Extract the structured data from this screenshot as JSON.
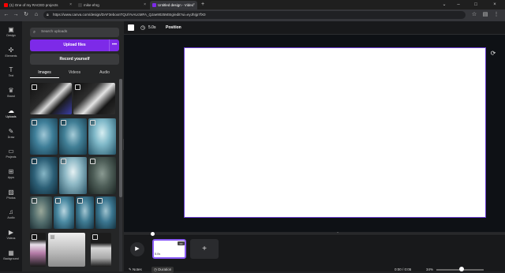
{
  "browser": {
    "tabs": [
      {
        "label": "(1) One of my RACED projects",
        "favicon_color": "#ff0000"
      },
      {
        "label": "mike ehrg",
        "favicon_color": "#3a3a3a"
      },
      {
        "label": "Untitled design - Video",
        "favicon_color": "#7d2ae8"
      }
    ],
    "new_tab_symbol": "+",
    "url": "https://www.canva.com/design/DAF3eboxnTQU/YvAUcMFA_QJae9025MSIg/edit?ui=eyJhIjp7fX0"
  },
  "rail": {
    "items": [
      {
        "label": "Design",
        "icon": "design-icon",
        "glyph": "▣"
      },
      {
        "label": "Elements",
        "icon": "elements-icon",
        "glyph": "✣"
      },
      {
        "label": "Text",
        "icon": "text-icon",
        "glyph": "T"
      },
      {
        "label": "Brand",
        "icon": "brand-icon",
        "glyph": "♛"
      },
      {
        "label": "Uploads",
        "icon": "uploads-icon",
        "glyph": "☁"
      },
      {
        "label": "Draw",
        "icon": "draw-icon",
        "glyph": "✎"
      },
      {
        "label": "Projects",
        "icon": "projects-icon",
        "glyph": "▭"
      },
      {
        "label": "Apps",
        "icon": "apps-icon",
        "glyph": "⊞"
      },
      {
        "label": "Photos",
        "icon": "photos-icon",
        "glyph": "▨"
      },
      {
        "label": "Audio",
        "icon": "audio-icon",
        "glyph": "♫"
      },
      {
        "label": "Videos",
        "icon": "videos-icon",
        "glyph": "▶"
      },
      {
        "label": "Background",
        "icon": "background-icon",
        "glyph": "▦"
      }
    ],
    "active": "Uploads"
  },
  "panel": {
    "search_placeholder": "Search uploads",
    "upload_button": "Upload files",
    "upload_more": "•••",
    "record_button": "Record yourself",
    "tabs": [
      "Images",
      "Videos",
      "Audio"
    ],
    "active_tab": "Images"
  },
  "toolbar": {
    "duration": "5.0s",
    "position": "Position"
  },
  "timeline": {
    "clip_label": "5.0s",
    "clip_more": "•••",
    "add_symbol": "+"
  },
  "bottombar": {
    "notes": "Notes",
    "duration": "Duration",
    "time": "0:00 / 0:05",
    "zoom": "34%"
  },
  "colors": {
    "accent": "#7d2ae8",
    "page_border": "#6b3fd4",
    "canvas_bg": "#0e1115"
  }
}
